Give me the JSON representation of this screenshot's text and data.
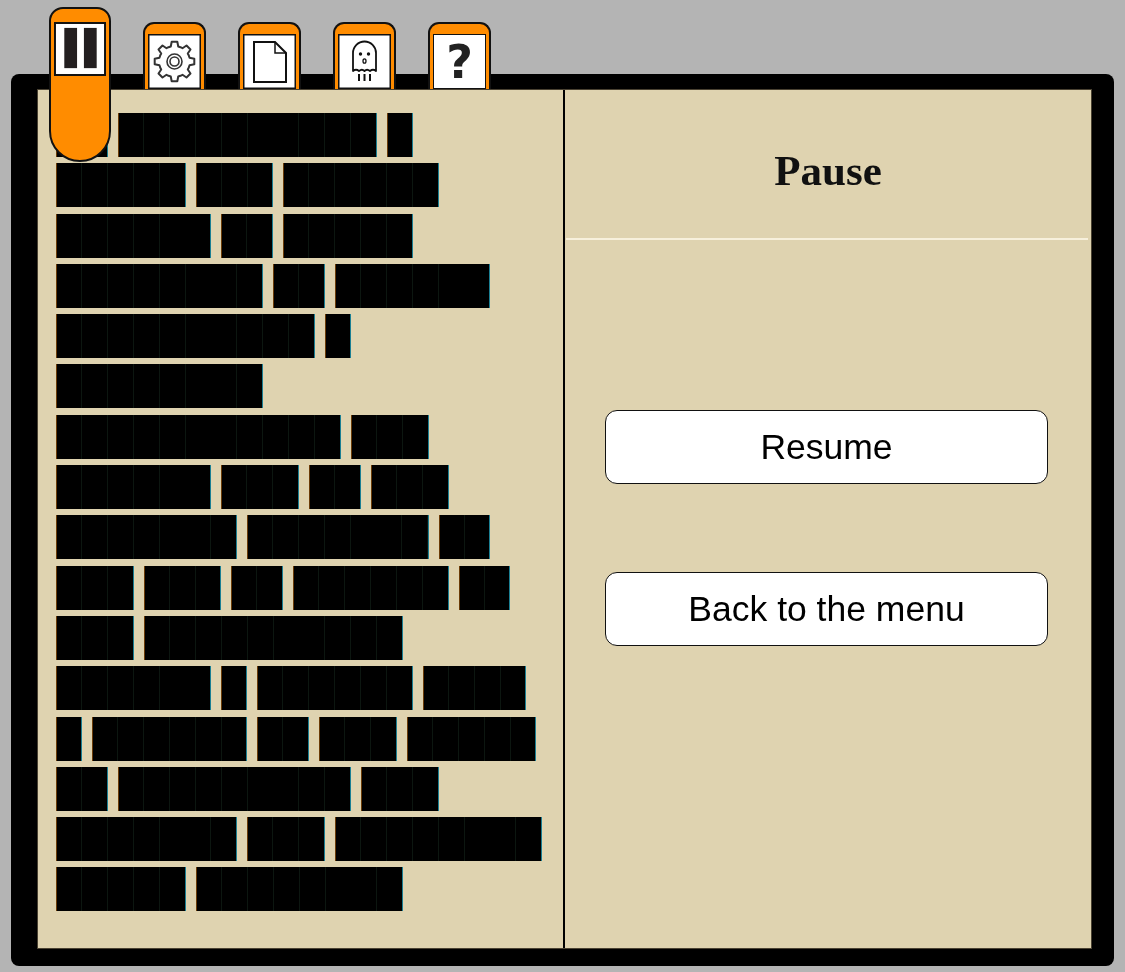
{
  "tabs": [
    {
      "kind": "pause",
      "selected": true
    },
    {
      "kind": "settings",
      "selected": false
    },
    {
      "kind": "document",
      "selected": false
    },
    {
      "kind": "ghost",
      "selected": false
    },
    {
      "kind": "help",
      "label": "?",
      "selected": false
    }
  ],
  "right_page": {
    "title": "Pause",
    "buttons": [
      "Resume",
      "Back to the menu"
    ]
  }
}
